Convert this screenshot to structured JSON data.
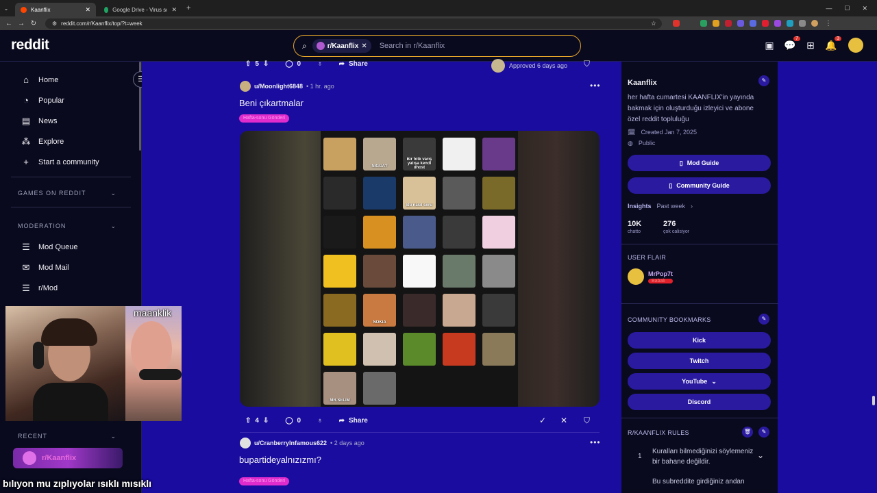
{
  "browser": {
    "tabs": [
      {
        "title": "Kaanflix",
        "active": true,
        "favicon_color": "#ff4500"
      },
      {
        "title": "Google Drive - Virus scan warn...",
        "active": false,
        "favicon_color": "#1fa463"
      }
    ],
    "url": "reddit.com/r/Kaanflix/top/?t=week"
  },
  "header": {
    "logo": "reddit",
    "search_chip": "r/Kaanflix",
    "search_placeholder": "Search in r/Kaanflix",
    "chat_badge": "7",
    "notif_badge": "3"
  },
  "sidebar": {
    "items": [
      {
        "label": "Home",
        "icon": "home-icon"
      },
      {
        "label": "Popular",
        "icon": "popular-icon"
      },
      {
        "label": "News",
        "icon": "news-icon"
      },
      {
        "label": "Explore",
        "icon": "explore-icon"
      },
      {
        "label": "Start a community",
        "icon": "plus-icon"
      }
    ],
    "games_section": "GAMES ON REDDIT",
    "moderation_section": "MODERATION",
    "mod_items": [
      {
        "label": "Mod Queue",
        "icon": "mod-queue-icon"
      },
      {
        "label": "Mod Mail",
        "icon": "mod-mail-icon"
      },
      {
        "label": "r/Mod",
        "icon": "r-mod-icon"
      }
    ],
    "recent_section": "RECENT",
    "recent_item": "r/Kaanflix"
  },
  "feed": {
    "top_post_actions": {
      "votes": "5",
      "comments": "0",
      "share": "Share",
      "approved": "Approved 6 days ago"
    },
    "post1": {
      "author": "u/Moonlight6848",
      "time": "1 hr. ago",
      "title": "Beni çıkartmalar",
      "flair": "Hafta-sonu Gönderi",
      "votes": "4",
      "comments": "0",
      "share": "Share"
    },
    "post2": {
      "author": "u/CranberryInfamous622",
      "time": "2 days ago",
      "title": "bupartideyalnızızmı?",
      "flair": "Hafta-sonu Gönderi"
    },
    "stickers": [
      {
        "text": "",
        "color": "#c8a060"
      },
      {
        "text": "NIGGA?",
        "color": "#b8a890"
      },
      {
        "text": "Bir fotk varış yatışa kendi ghost",
        "color": "#3a3a3a"
      },
      {
        "text": "",
        "color": "#f0f0f0"
      },
      {
        "text": "",
        "color": "#6a3a8a"
      },
      {
        "text": "",
        "color": "#2a2a2a"
      },
      {
        "text": "",
        "color": "#1a3a6a"
      },
      {
        "text": "Bu nasıl soru",
        "color": "#d8c098"
      },
      {
        "text": "",
        "color": "#5a5a5a"
      },
      {
        "text": "",
        "color": "#7a6a2a"
      },
      {
        "text": "",
        "color": "#1a1a1a"
      },
      {
        "text": "",
        "color": "#d89020"
      },
      {
        "text": "",
        "color": "#4a5a8a"
      },
      {
        "text": "",
        "color": "#3a3a3a"
      },
      {
        "text": "",
        "color": "#f0d0e0"
      },
      {
        "text": "",
        "color": "#f0c020"
      },
      {
        "text": "",
        "color": "#6a4a3a"
      },
      {
        "text": "",
        "color": "#f8f8f8"
      },
      {
        "text": "",
        "color": "#6a7a6a"
      },
      {
        "text": "",
        "color": "#8a8a8a"
      },
      {
        "text": "",
        "color": "#8a6a20"
      },
      {
        "text": "NOKIA",
        "color": "#c87a40"
      },
      {
        "text": "",
        "color": "#3a2a2a"
      },
      {
        "text": "",
        "color": "#c8a890"
      },
      {
        "text": "",
        "color": "#3a3a3a"
      },
      {
        "text": "",
        "color": "#e0c020"
      },
      {
        "text": "",
        "color": "#d0c0b0"
      },
      {
        "text": "",
        "color": "#5a8a2a"
      },
      {
        "text": "",
        "color": "#c83a20"
      },
      {
        "text": "",
        "color": "#8a7a5a"
      },
      {
        "text": "MR.SELIM",
        "color": "#a89080"
      },
      {
        "text": "",
        "color": "#6a6a6a"
      }
    ]
  },
  "right_panel": {
    "name": "Kaanflix",
    "description": "her hafta cumartesi KAANFLIX'in yayında bakmak için oluşturduğu izleyici ve abone özel reddit topluluğu",
    "created": "Created Jan 7, 2025",
    "visibility": "Public",
    "mod_guide": "Mod Guide",
    "community_guide": "Community Guide",
    "insights_label": "Insights",
    "insights_period": "Past week",
    "stat1_value": "10K",
    "stat1_label": "chatto",
    "stat2_value": "276",
    "stat2_label": "çok calisiyor",
    "user_flair_heading": "USER FLAIR",
    "user_flair_name": "MrPop7t",
    "user_flair_tag": "Babalı",
    "bookmarks_heading": "COMMUNITY BOOKMARKS",
    "bookmarks": [
      "Kick",
      "Twitch",
      "YouTube",
      "Discord"
    ],
    "rules_heading": "R/KAANFLIX RULES",
    "rule1_num": "1",
    "rule1_text": "Kuralları bilmediğinizi söylemeniz bir bahane değildir.",
    "rule2_text": "Bu subreddite girdiğiniz andan"
  },
  "overlay": {
    "cam_name": "maanklik",
    "subtitle": "bılıyon mu zıplıyolar ısıklı mısıklı"
  },
  "colors": {
    "accent_orange": "#e8a72a",
    "feed_bg": "#1a0c9e",
    "panel_bg": "#0a0a1f",
    "flair_pink": "#e02ccc",
    "button_purple": "#2a1aa0"
  }
}
